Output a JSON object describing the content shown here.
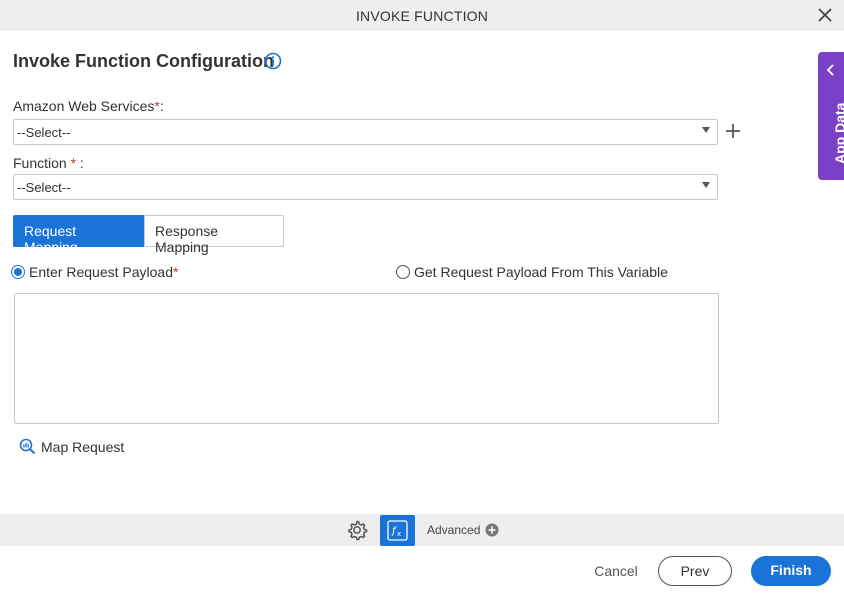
{
  "window": {
    "title": "INVOKE FUNCTION"
  },
  "heading": "Invoke Function Configuration",
  "aws": {
    "label": "Amazon Web Services",
    "required_mark": "*",
    "suffix": ":",
    "value": "--Select--"
  },
  "function": {
    "label": "Function ",
    "required_mark": "*",
    "suffix": " :",
    "value": "--Select--"
  },
  "tabs": [
    {
      "label": "Request Mapping",
      "active": true
    },
    {
      "label": "Response Mapping",
      "active": false
    }
  ],
  "radios": [
    {
      "label": "Enter Request Payload",
      "required_mark": "*",
      "checked": true
    },
    {
      "label": "Get Request Payload From This Variable",
      "checked": false
    }
  ],
  "payload": {
    "value": ""
  },
  "map_request": {
    "label": "Map Request"
  },
  "side_panel": {
    "label": "App Data"
  },
  "toolbar": {
    "advanced_label": "Advanced"
  },
  "footer": {
    "cancel": "Cancel",
    "prev": "Prev",
    "finish": "Finish"
  },
  "colors": {
    "primary": "#1a73d6",
    "side_panel": "#7c3fc8",
    "required": "#c0392b"
  },
  "icons": [
    "close-icon",
    "info-icon",
    "plus-icon",
    "caret-down-icon",
    "map-request-icon",
    "chevron-left-icon",
    "gear-icon",
    "fx-icon",
    "circle-plus-icon"
  ]
}
